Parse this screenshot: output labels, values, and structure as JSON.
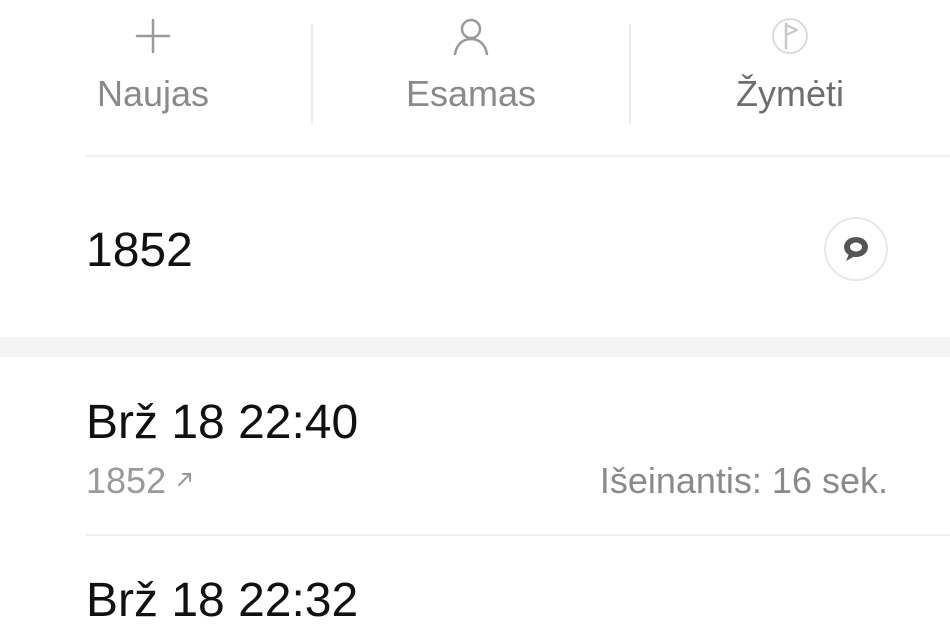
{
  "actions": {
    "new_label": "Naujas",
    "existing_label": "Esamas",
    "mark_label": "Žymėti",
    "icons": {
      "new": "plus-icon",
      "existing": "person-icon",
      "mark": "flag-icon"
    }
  },
  "contact": {
    "number": "1852",
    "message_icon": "message-bubble-icon"
  },
  "call_log": [
    {
      "date": "Brž 18 22:40",
      "number": "1852",
      "direction_icon": "outgoing-arrow-icon",
      "detail": "Išeinantis: 16 sek."
    },
    {
      "date": "Brž 18 22:32"
    }
  ],
  "colors": {
    "label_gray": "#8a8a8a",
    "text_dark": "#111111",
    "divider": "#f0f0f0"
  }
}
